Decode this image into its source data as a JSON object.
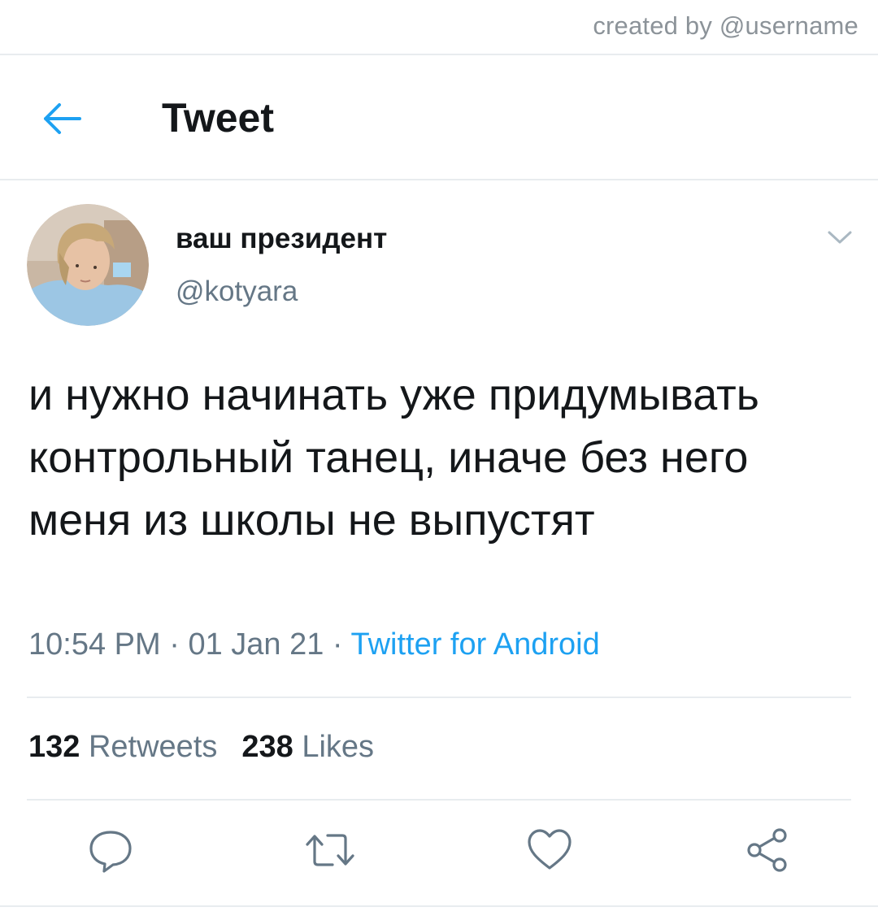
{
  "watermark": "created by @username",
  "header": {
    "title": "Tweet",
    "back_icon": "back-arrow-icon"
  },
  "tweet": {
    "author": {
      "display_name": "ваш президент",
      "handle": "@kotyara"
    },
    "text": "и нужно начинать уже придумывать контрольный танец, иначе без него меня из школы не выпустят",
    "time": "10:54 PM",
    "date": "01 Jan 21",
    "separator": " · ",
    "source": "Twitter for Android",
    "retweets_count": "132",
    "retweets_label": "Retweets",
    "likes_count": "238",
    "likes_label": "Likes"
  },
  "actions": [
    "reply-icon",
    "retweet-icon",
    "like-icon",
    "share-icon"
  ],
  "colors": {
    "accent": "#1da1f2",
    "text_primary": "#14171a",
    "text_secondary": "#657786",
    "divider": "#e8ecef"
  }
}
